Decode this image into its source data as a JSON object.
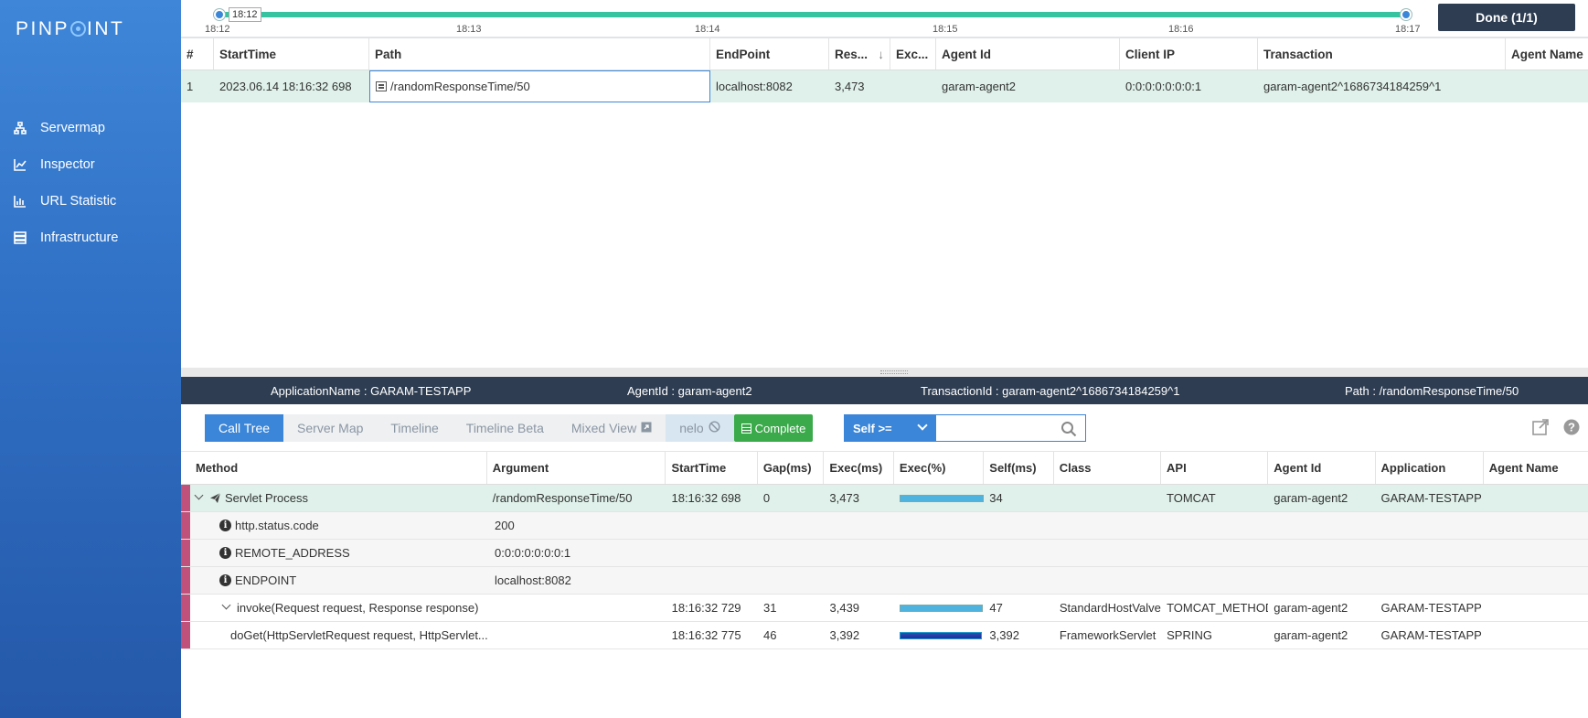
{
  "app": {
    "logo": "PINPOINT"
  },
  "sidebar": {
    "items": [
      {
        "label": "Servermap",
        "icon": "sitemap-icon"
      },
      {
        "label": "Inspector",
        "icon": "chart-line-icon"
      },
      {
        "label": "URL Statistic",
        "icon": "bar-chart-icon"
      },
      {
        "label": "Infrastructure",
        "icon": "server-icon"
      }
    ]
  },
  "timeline": {
    "current_tag": "18:12",
    "ticks": [
      "18:12",
      "18:13",
      "18:14",
      "18:15",
      "18:16",
      "18:17"
    ],
    "done_label": "Done (1/1)"
  },
  "transactions": {
    "columns": [
      "#",
      "StartTime",
      "Path",
      "EndPoint",
      "Res...",
      "Exc...",
      "Agent Id",
      "Client IP",
      "Transaction",
      "Agent Name"
    ],
    "rows": [
      {
        "num": "1",
        "start_time": "2023.06.14 18:16:32 698",
        "path": "/randomResponseTime/50",
        "endpoint": "localhost:8082",
        "response": "3,473",
        "exception": "",
        "agent_id": "garam-agent2",
        "client_ip": "0:0:0:0:0:0:0:1",
        "transaction": "garam-agent2^1686734184259^1",
        "agent_name": ""
      }
    ]
  },
  "info_bar": {
    "application_name": "ApplicationName : GARAM-TESTAPP",
    "agent_id": "AgentId : garam-agent2",
    "transaction_id": "TransactionId : garam-agent2^1686734184259^1",
    "path": "Path : /randomResponseTime/50"
  },
  "tabs": {
    "items": [
      "Call Tree",
      "Server Map",
      "Timeline",
      "Timeline Beta",
      "Mixed View",
      "nelo"
    ],
    "active": "Call Tree",
    "complete_label": "Complete",
    "self_select": "Self >=",
    "self_input_value": ""
  },
  "call_tree": {
    "columns": [
      "Method",
      "Argument",
      "StartTime",
      "Gap(ms)",
      "Exec(ms)",
      "Exec(%)",
      "Self(ms)",
      "Class",
      "API",
      "Agent Id",
      "Application",
      "Agent Name"
    ],
    "rows": [
      {
        "method": "Servlet Process",
        "argument": "/randomResponseTime/50",
        "start_time": "18:16:32 698",
        "gap": "0",
        "exec": "3,473",
        "exec_pct": 1.0,
        "self": "34",
        "class": "",
        "api": "TOMCAT",
        "agent_id": "garam-agent2",
        "application": "GARAM-TESTAPP",
        "agent_name": ""
      },
      {
        "method": "http.status.code",
        "argument": "200",
        "start_time": "",
        "gap": "",
        "exec": "",
        "exec_pct": null,
        "self": "",
        "class": "",
        "api": "",
        "agent_id": "",
        "application": "",
        "agent_name": ""
      },
      {
        "method": "REMOTE_ADDRESS",
        "argument": "0:0:0:0:0:0:0:1",
        "start_time": "",
        "gap": "",
        "exec": "",
        "exec_pct": null,
        "self": "",
        "class": "",
        "api": "",
        "agent_id": "",
        "application": "",
        "agent_name": ""
      },
      {
        "method": "ENDPOINT",
        "argument": "localhost:8082",
        "start_time": "",
        "gap": "",
        "exec": "",
        "exec_pct": null,
        "self": "",
        "class": "",
        "api": "",
        "agent_id": "",
        "application": "",
        "agent_name": ""
      },
      {
        "method": "invoke(Request request, Response response)",
        "argument": "",
        "start_time": "18:16:32 729",
        "gap": "31",
        "exec": "3,439",
        "exec_pct": 0.99,
        "self": "47",
        "class": "StandardHostValve",
        "api": "TOMCAT_METHOD",
        "agent_id": "garam-agent2",
        "application": "GARAM-TESTAPP",
        "agent_name": ""
      },
      {
        "method": "doGet(HttpServletRequest request, HttpServlet...",
        "argument": "",
        "start_time": "18:16:32 775",
        "gap": "46",
        "exec": "3,392",
        "exec_pct": 0.98,
        "self": "3,392",
        "class": "FrameworkServlet",
        "api": "SPRING",
        "agent_id": "garam-agent2",
        "application": "GARAM-TESTAPP",
        "agent_name": ""
      }
    ]
  }
}
